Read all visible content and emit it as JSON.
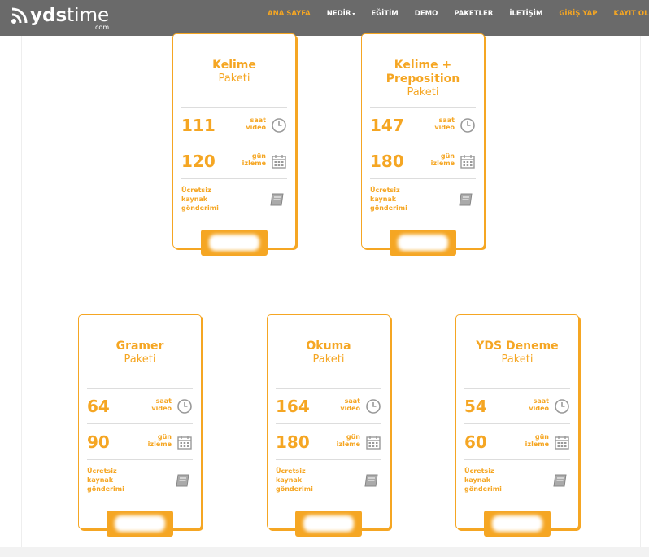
{
  "brand": {
    "bold": "yds",
    "light": "time",
    "sub": ".com"
  },
  "nav": [
    {
      "label": "ANA SAYFA",
      "style": "active"
    },
    {
      "label": "NEDİR",
      "caret": true
    },
    {
      "label": "EĞİTİM"
    },
    {
      "label": "DEMO"
    },
    {
      "label": "PAKETLER"
    },
    {
      "label": "İLETİŞİM"
    },
    {
      "label": "GİRİŞ YAP",
      "style": "accent"
    },
    {
      "label": "KAYIT OL",
      "style": "accent"
    }
  ],
  "common": {
    "hours_unit_line1": "saat",
    "hours_unit_line2": "video",
    "days_unit_line1": "gün",
    "days_unit_line2": "izleme",
    "free_line1": "Ücretsiz",
    "free_line2": "kaynak",
    "free_line3": "gönderimi"
  },
  "packages": [
    {
      "title_line1": "Kelime",
      "title_line2": "",
      "subtitle": "Paketi",
      "hours": "111",
      "days": "120"
    },
    {
      "title_line1": "Kelime +",
      "title_line2": "Preposition",
      "subtitle": "Paketi",
      "hours": "147",
      "days": "180"
    },
    {
      "title_line1": "Gramer",
      "title_line2": "",
      "subtitle": "Paketi",
      "hours": "64",
      "days": "90"
    },
    {
      "title_line1": "Okuma",
      "title_line2": "",
      "subtitle": "Paketi",
      "hours": "164",
      "days": "180"
    },
    {
      "title_line1": "YDS Deneme",
      "title_line2": "",
      "subtitle": "Paketi",
      "hours": "54",
      "days": "60"
    }
  ],
  "colors": {
    "accent": "#f5a623",
    "navbar": "#6a6a6a",
    "icon": "#999999"
  }
}
